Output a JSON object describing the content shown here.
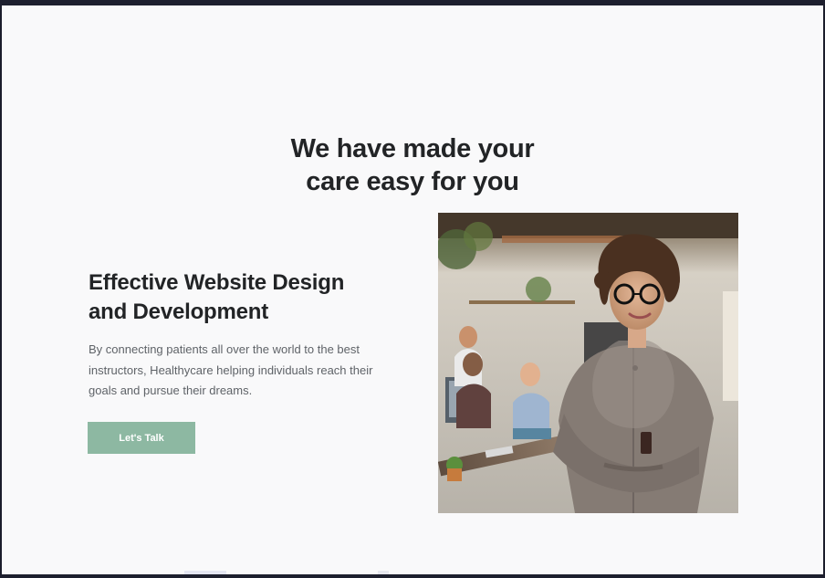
{
  "hero": {
    "heading_line1": "We have made your",
    "heading_line2": "care easy for you"
  },
  "feature": {
    "title_line1": "Effective Website Design",
    "title_line2": "and Development",
    "description": "By connecting patients all over the world to the best instructors, Healthycare helping individuals reach their goals and pursue their dreams.",
    "cta_label": "Let's Talk"
  },
  "colors": {
    "accent": "#8db8a2",
    "text_dark": "#222426",
    "text_muted": "#5f6368",
    "background": "#f9f9fa"
  }
}
